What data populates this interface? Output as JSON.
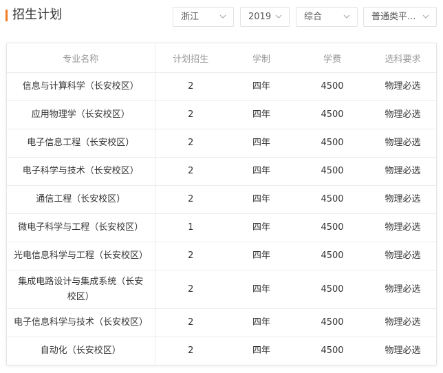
{
  "header": {
    "title": "招生计划",
    "accent_color": "#f07b22"
  },
  "filters": {
    "province": "浙江",
    "year": "2019",
    "category": "综合",
    "batch": "普通类平...",
    "chevron_icon": "chevron-down-icon"
  },
  "table": {
    "columns": [
      "专业名称",
      "计划招生",
      "学制",
      "学费",
      "选科要求"
    ],
    "rows": [
      {
        "name": "信息与计算科学（长安校区）",
        "plan": "2",
        "duration": "四年",
        "fee": "4500",
        "requirement": "物理必选"
      },
      {
        "name": "应用物理学（长安校区）",
        "plan": "2",
        "duration": "四年",
        "fee": "4500",
        "requirement": "物理必选"
      },
      {
        "name": "电子信息工程（长安校区）",
        "plan": "2",
        "duration": "四年",
        "fee": "4500",
        "requirement": "物理必选"
      },
      {
        "name": "电子科学与技术（长安校区）",
        "plan": "2",
        "duration": "四年",
        "fee": "4500",
        "requirement": "物理必选"
      },
      {
        "name": "通信工程（长安校区）",
        "plan": "2",
        "duration": "四年",
        "fee": "4500",
        "requirement": "物理必选"
      },
      {
        "name": "微电子科学与工程（长安校区）",
        "plan": "1",
        "duration": "四年",
        "fee": "4500",
        "requirement": "物理必选"
      },
      {
        "name": "光电信息科学与工程（长安校区）",
        "plan": "2",
        "duration": "四年",
        "fee": "4500",
        "requirement": "物理必选"
      },
      {
        "name": "集成电路设计与集成系统（长安校区）",
        "plan": "2",
        "duration": "四年",
        "fee": "4500",
        "requirement": "物理必选"
      },
      {
        "name": "电子信息科学与技术（长安校区）",
        "plan": "2",
        "duration": "四年",
        "fee": "4500",
        "requirement": "物理必选"
      },
      {
        "name": "自动化（长安校区）",
        "plan": "2",
        "duration": "四年",
        "fee": "4500",
        "requirement": "物理必选"
      }
    ]
  }
}
